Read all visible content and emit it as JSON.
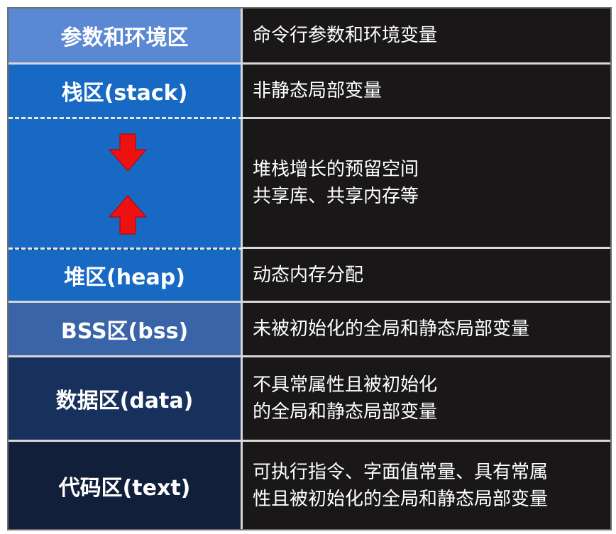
{
  "rows": [
    {
      "label": "参数和环境区",
      "desc": [
        "命令行参数和环境变量"
      ]
    },
    {
      "label": "栈区(stack)",
      "desc": [
        "非静态局部变量"
      ]
    },
    {
      "label": "",
      "desc": [
        "堆栈增长的预留空间",
        "共享库、共享内存等"
      ]
    },
    {
      "label": "堆区(heap)",
      "desc": [
        "动态内存分配"
      ]
    },
    {
      "label": "BSS区(bss)",
      "desc": [
        "未被初始化的全局和静态局部变量"
      ]
    },
    {
      "label": "数据区(data)",
      "desc": [
        "不具常属性且被初始化",
        "的全局和静态局部变量"
      ]
    },
    {
      "label": "代码区(text)",
      "desc": [
        "可执行指令、字面值常量、具有常属",
        "性且被初始化的全局和静态局部变量"
      ]
    }
  ],
  "colors": {
    "env": "#5a88d2",
    "stack": "#1769c4",
    "heap": "#1769c4",
    "bss": "#3a64a8",
    "data": "#17315c",
    "text": "#111f3a",
    "arrow": "#ee1111",
    "dark": "#1a1718"
  },
  "icons": {
    "down": "arrow-down-icon",
    "up": "arrow-up-icon"
  }
}
